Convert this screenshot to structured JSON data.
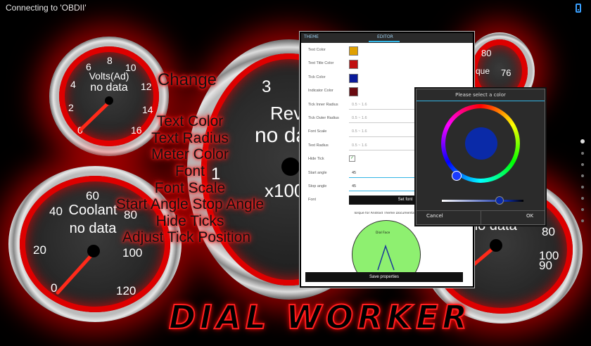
{
  "status_bar": {
    "title": "Connecting to 'OBDII'",
    "icon": "phone-icon"
  },
  "gauges": {
    "volts": {
      "label": "Volts(Ad)",
      "value": "no data",
      "ticks": [
        "0",
        "2",
        "4",
        "6",
        "8",
        "10",
        "12",
        "14",
        "16"
      ]
    },
    "revs": {
      "label": "Rev",
      "value": "no da",
      "ticks": [
        "1",
        "3"
      ],
      "multiplier": "x100"
    },
    "coolant": {
      "label": "Coolant",
      "value": "no data",
      "ticks": [
        "0",
        "20",
        "40",
        "60",
        "80",
        "100",
        "120"
      ]
    },
    "torque": {
      "label": "que",
      "ticks": [
        "80",
        "76"
      ]
    },
    "speed": {
      "value": "no data",
      "ticks": [
        "100",
        "90",
        "80",
        "0"
      ]
    }
  },
  "overlay_text": [
    "Change",
    "Text Color",
    "Text Radius",
    "Meter Color",
    "Font",
    "Font Scale",
    "Start Angle Stop Angle",
    "Hide Ticks",
    "Adjust Tick Position"
  ],
  "editor": {
    "tabs": [
      "THEME",
      "EDITOR"
    ],
    "rows": [
      {
        "label": "Text Color",
        "type": "swatch",
        "color": "#e0a000"
      },
      {
        "label": "Text Title Color",
        "type": "swatch",
        "color": "#c01010"
      },
      {
        "label": "Tick Color",
        "type": "swatch",
        "color": "#0a1a9a"
      },
      {
        "label": "Indicator Color",
        "type": "swatch",
        "color": "#6a0a10"
      },
      {
        "label": "Tick Inner Radius",
        "type": "range",
        "value": "0.5 ~ 1.6"
      },
      {
        "label": "Tick Outer Radius",
        "type": "range",
        "value": "0.5 ~ 1.6"
      },
      {
        "label": "Font Scale",
        "type": "range",
        "value": "0.5 ~ 1.6"
      },
      {
        "label": "Text Radius",
        "type": "range",
        "value": "0.5 ~ 1.6"
      },
      {
        "label": "Hide Tick",
        "type": "check",
        "value": "✓"
      },
      {
        "label": "Start angle",
        "type": "input",
        "value": "45"
      },
      {
        "label": "Stop angle",
        "type": "input",
        "value": "45"
      },
      {
        "label": "Font",
        "type": "button",
        "value": "Set font"
      }
    ],
    "preview_title": "Torque for Android Theme Documentation",
    "preview_label": "Dial Face",
    "save_button": "Save properties"
  },
  "color_picker": {
    "title": "Please select a color",
    "cancel": "Cancel",
    "ok": "OK",
    "selected_color": "#0a2aa8"
  },
  "logo": "DIAL WORKER",
  "page_dots": {
    "count": 8,
    "active": 0
  },
  "colors": {
    "accent": "#33b5e5",
    "gauge_red": "#ff2020"
  }
}
